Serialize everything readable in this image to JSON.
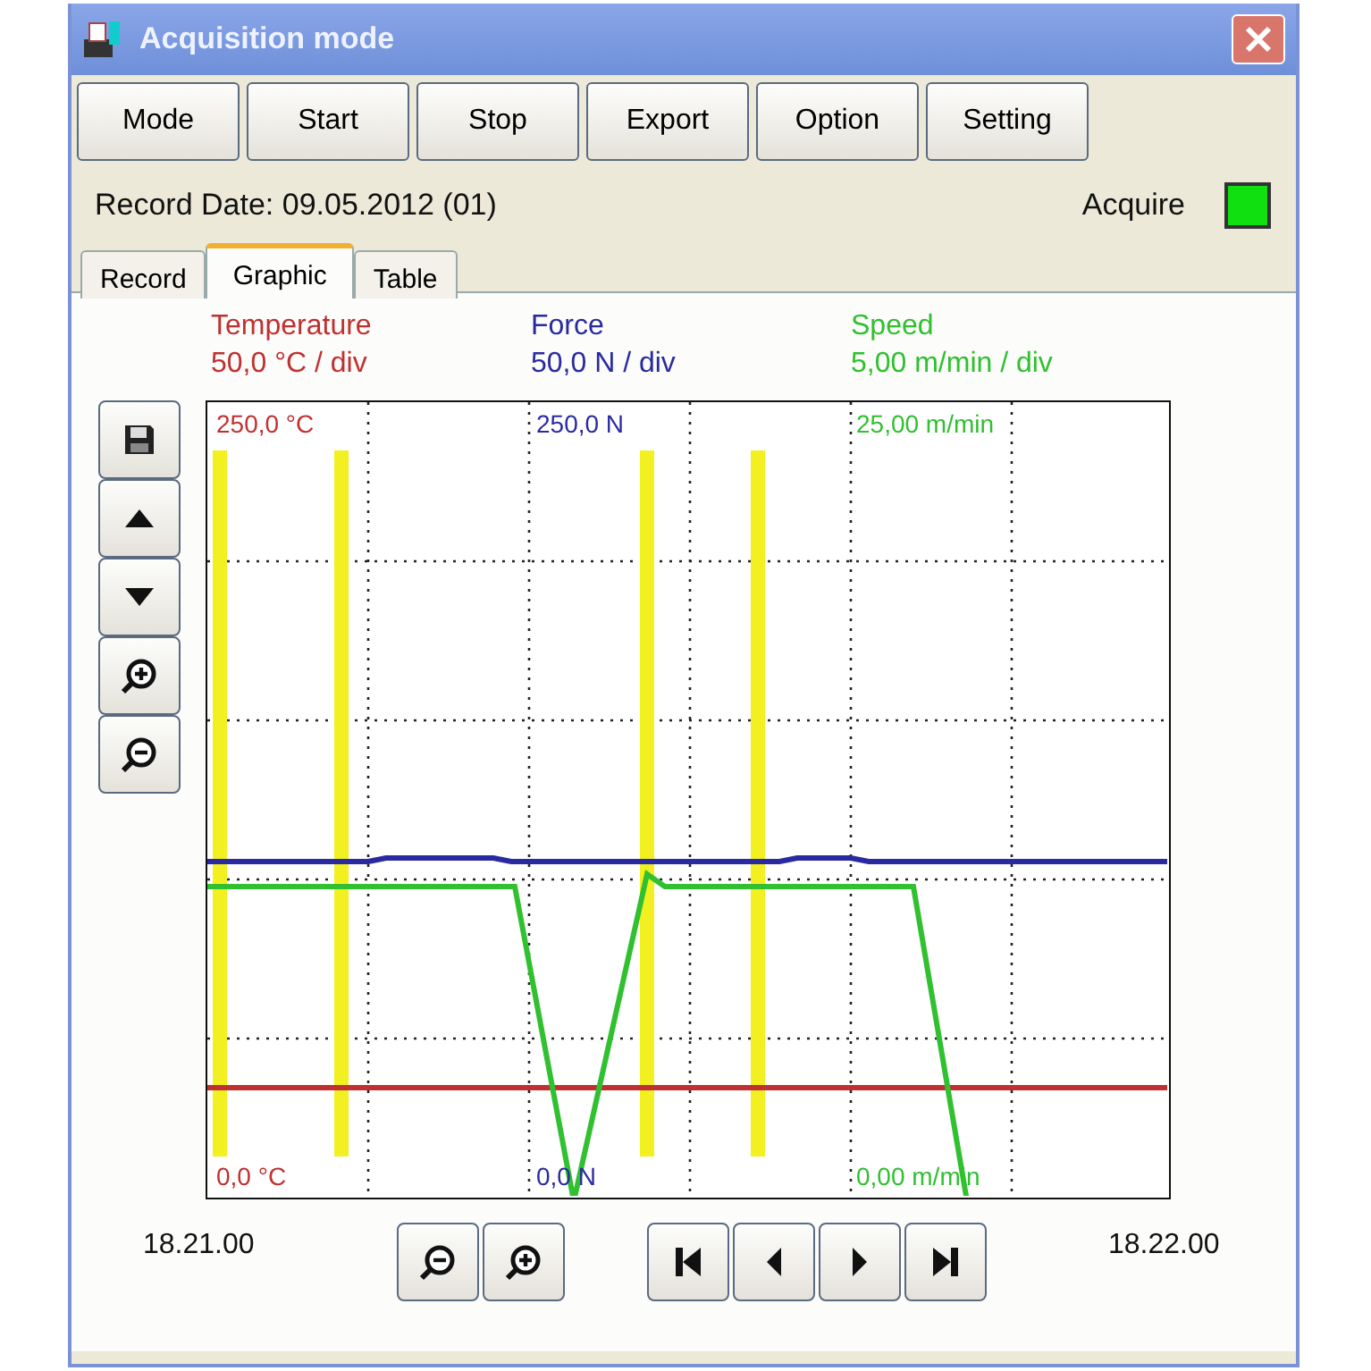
{
  "window": {
    "title": "Acquisition mode"
  },
  "toolbar": [
    {
      "label": "Mode"
    },
    {
      "label": "Start"
    },
    {
      "label": "Stop"
    },
    {
      "label": "Export"
    },
    {
      "label": "Option"
    },
    {
      "label": "Setting"
    }
  ],
  "record_date": "Record Date: 09.05.2012 (01)",
  "acquire": {
    "label": "Acquire",
    "on": true
  },
  "tabs": [
    {
      "label": "Record",
      "selected": false
    },
    {
      "label": "Graphic",
      "selected": true
    },
    {
      "label": "Table",
      "selected": false
    }
  ],
  "channels": [
    {
      "name": "Temperature",
      "scale": "50,0 °C / div",
      "max": "250,0 °C",
      "min": "0,0 °C",
      "color": "#c03030"
    },
    {
      "name": "Force",
      "scale": "50,0 N / div",
      "max": "250,0 N",
      "min": "0,0 N",
      "color": "#2a2aa0"
    },
    {
      "name": "Speed",
      "scale": "5,00 m/min / div",
      "max": "25,00 m/min",
      "min": "0,00 m/min",
      "color": "#30c030"
    }
  ],
  "side_buttons": [
    {
      "kind": "save"
    },
    {
      "kind": "up"
    },
    {
      "kind": "down"
    },
    {
      "kind": "zoom_in"
    },
    {
      "kind": "zoom_out"
    }
  ],
  "time_start": "18.21.00",
  "time_end": "18.22.00",
  "zoom_buttons": [
    {
      "kind": "zoom_out"
    },
    {
      "kind": "zoom_in"
    }
  ],
  "nav_buttons": [
    {
      "kind": "first"
    },
    {
      "kind": "prev"
    },
    {
      "kind": "next"
    },
    {
      "kind": "last"
    }
  ]
}
